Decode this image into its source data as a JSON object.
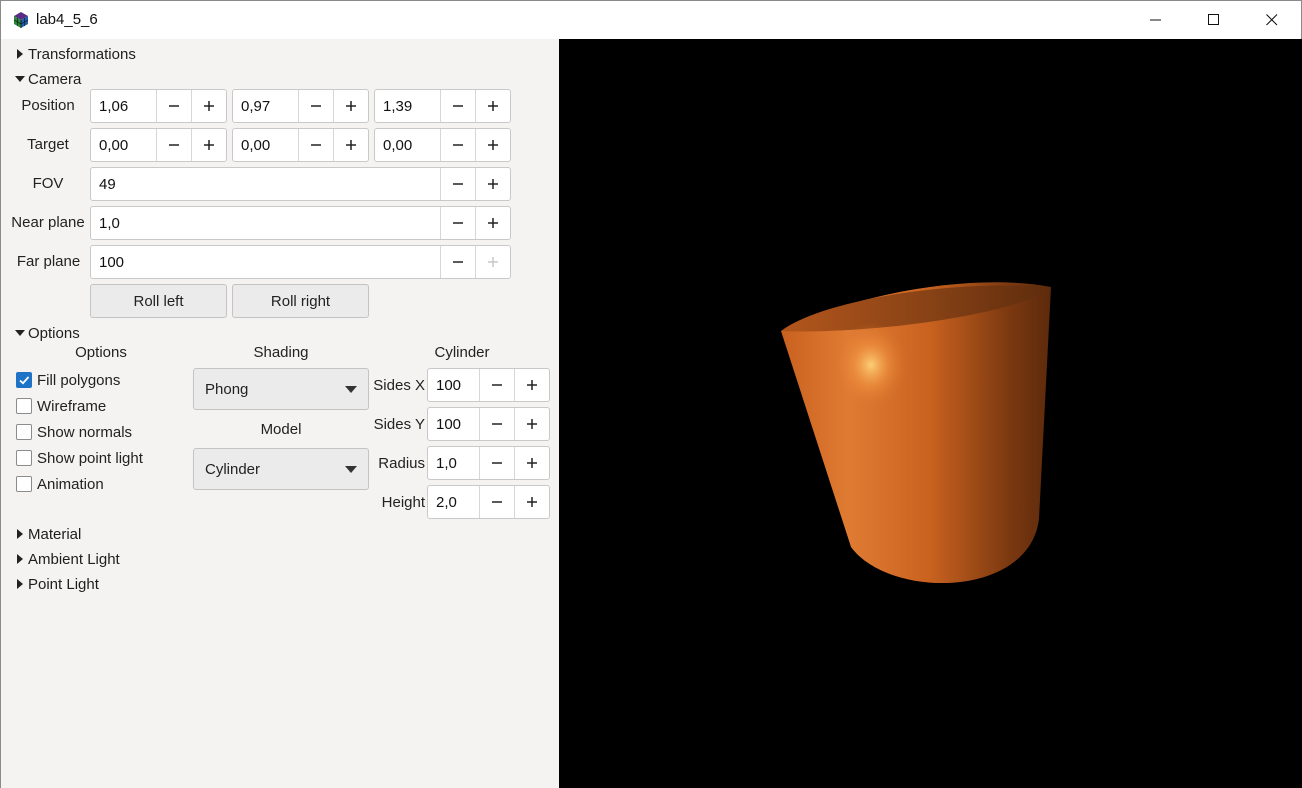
{
  "window": {
    "title": "lab4_5_6"
  },
  "sections": {
    "transformations": "Transformations",
    "camera": "Camera",
    "options": "Options",
    "material": "Material",
    "ambient_light": "Ambient Light",
    "point_light": "Point Light"
  },
  "camera": {
    "position_label": "Position",
    "position": [
      "1,06",
      "0,97",
      "1,39"
    ],
    "target_label": "Target",
    "target": [
      "0,00",
      "0,00",
      "0,00"
    ],
    "fov_label": "FOV",
    "fov": "49",
    "near_label": "Near plane",
    "near": "1,0",
    "far_label": "Far plane",
    "far": "100",
    "roll_left": "Roll left",
    "roll_right": "Roll right"
  },
  "options": {
    "options_col_header": "Options",
    "checkboxes": [
      {
        "label": "Fill polygons",
        "checked": true
      },
      {
        "label": "Wireframe",
        "checked": false
      },
      {
        "label": "Show normals",
        "checked": false
      },
      {
        "label": "Show point light",
        "checked": false
      },
      {
        "label": "Animation",
        "checked": false
      }
    ],
    "shading_header": "Shading",
    "shading_value": "Phong",
    "model_header": "Model",
    "model_value": "Cylinder",
    "cylinder_header": "Cylinder",
    "sides_x_label": "Sides X",
    "sides_x": "100",
    "sides_y_label": "Sides Y",
    "sides_y": "100",
    "radius_label": "Radius",
    "radius": "1,0",
    "height_label": "Height",
    "height": "2,0"
  },
  "icons": {
    "minus": "minus-icon",
    "plus": "plus-icon",
    "minimize": "minimize-icon",
    "maximize": "maximize-icon",
    "close": "close-icon"
  },
  "colors": {
    "viewport_bg": "#000000",
    "panel_bg": "#f4f3f2",
    "object_color": "#d8722e",
    "checkbox_accent": "#1e73c7"
  }
}
